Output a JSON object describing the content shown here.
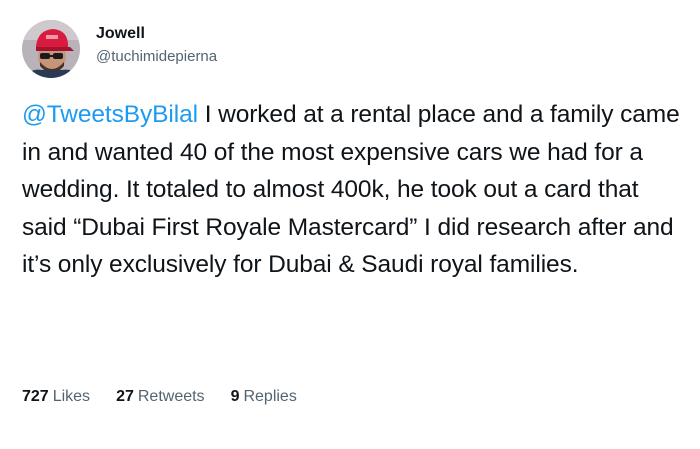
{
  "user": {
    "display_name": "Jowell",
    "handle": "@tuchimidepierna",
    "avatar_icon": "user-avatar-photo"
  },
  "tweet": {
    "mention": "@TweetsByBilal",
    "text": " I worked at a rental place and a family came in and wanted 40 of the most expensive cars we had for a wedding. It totaled to almost 400k, he took out a card that said “Dubai First Royale Mastercard” I did research after and it’s only exclusively for Dubai & Saudi royal families."
  },
  "stats": {
    "likes": {
      "count": "727",
      "label": "Likes"
    },
    "retweets": {
      "count": "27",
      "label": "Retweets"
    },
    "replies": {
      "count": "9",
      "label": "Replies"
    }
  },
  "colors": {
    "link": "#1d9bf0",
    "text": "#0f1419",
    "secondary": "#536471"
  }
}
